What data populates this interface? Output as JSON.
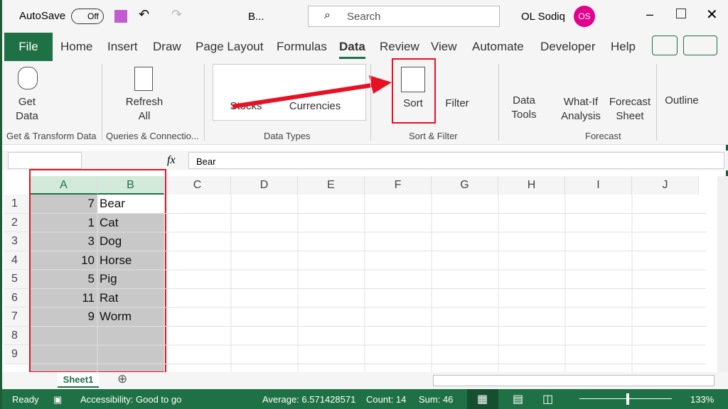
{
  "title_bar": {
    "autosave": "AutoSave",
    "autosave_state": "Off",
    "filename": "B...",
    "search_placeholder": "Search",
    "user": "OL Sodiq",
    "avatar": "OS"
  },
  "tabs": [
    "File",
    "Home",
    "Insert",
    "Draw",
    "Page Layout",
    "Formulas",
    "Data",
    "Review",
    "View",
    "Automate",
    "Developer",
    "Help"
  ],
  "ribbon": {
    "get_data": "Get Data",
    "refresh_all": "Refresh All",
    "stocks": "Stocks",
    "currencies": "Currencies",
    "sort": "Sort",
    "filter": "Filter",
    "data_tools": "Data Tools",
    "what_if": "What-If Analysis",
    "forecast_sheet": "Forecast Sheet",
    "outline": "Outline",
    "groups": [
      "Get & Transform Data",
      "Queries & Connectio...",
      "Data Types",
      "Sort & Filter",
      "Forecast"
    ]
  },
  "formula_bar": {
    "fx": "fx",
    "value": "Bear"
  },
  "columns": [
    "A",
    "B",
    "C",
    "D",
    "E",
    "F",
    "G",
    "H",
    "I",
    "J"
  ],
  "rows": [
    "1",
    "2",
    "3",
    "4",
    "5",
    "6",
    "7",
    "8",
    "9"
  ],
  "cells": [
    [
      "7",
      "Bear"
    ],
    [
      "1",
      "Cat"
    ],
    [
      "3",
      "Dog"
    ],
    [
      "10",
      "Horse"
    ],
    [
      "5",
      "Pig"
    ],
    [
      "11",
      "Rat"
    ],
    [
      "9",
      "Worm"
    ]
  ],
  "sheet_tab": "Sheet1",
  "status": {
    "ready": "Ready",
    "accessibility": "Accessibility: Good to go",
    "average": "Average: 6.571428571",
    "count": "Count: 14",
    "sum": "Sum: 46",
    "zoom": "133%"
  },
  "colors": {
    "accent": "#1e7145",
    "highlight": "#e81123"
  }
}
